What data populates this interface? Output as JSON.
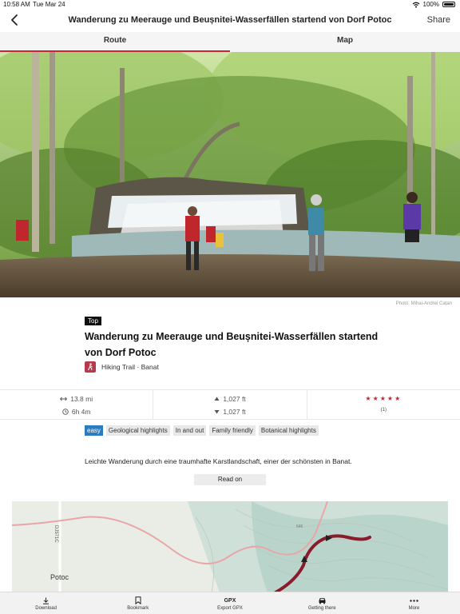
{
  "status": {
    "time": "10:58 AM",
    "date": "Tue Mar 24",
    "battery": "100%"
  },
  "nav": {
    "title": "Wanderung  zu Meerauge und Beușnitei-Wasserfällen startend von Dorf Potoc",
    "share": "Share",
    "tabs": [
      {
        "label": "Route",
        "active": true
      },
      {
        "label": "Map",
        "active": false
      }
    ]
  },
  "hero": {
    "credit": "Photo: Mihai-Andrei Cațan"
  },
  "tour": {
    "badge": "Top",
    "title": "Wanderung zu Meerauge und Beușnitei-Wasserfällen startend von Dorf Potoc",
    "type": "Hiking Trail · Banat"
  },
  "stats": {
    "distance": "13.8 mi",
    "duration": "6h 4m",
    "ascent": "1,027 ft",
    "descent": "1,027 ft",
    "stars": "★★★★★",
    "rating_count": "(1)"
  },
  "tags": [
    "easy",
    "Geological highlights",
    "In and out",
    "Family friendly",
    "Botanical highlights"
  ],
  "description": {
    "text": "Leichte Wanderung durch eine traumhafte Karstlandschaft, einer der schönsten in Banat.",
    "read_on": "Read on"
  },
  "map": {
    "place_label": "Potoc",
    "road_label": "DJ571C",
    "elevation_label": "646"
  },
  "toolbar": [
    {
      "label": "Download",
      "icon": "download-icon"
    },
    {
      "label": "Bookmark",
      "icon": "bookmark-icon"
    },
    {
      "label": "Export GPX",
      "icon": "gpx-icon",
      "icon_text": "GPX"
    },
    {
      "label": "Getting there",
      "icon": "car-icon"
    },
    {
      "label": "More",
      "icon": "more-icon"
    }
  ],
  "colors": {
    "accent": "#c8262f",
    "easy": "#2b7bbf",
    "hiking": "#b8394d",
    "route": "#8b1a2b"
  }
}
